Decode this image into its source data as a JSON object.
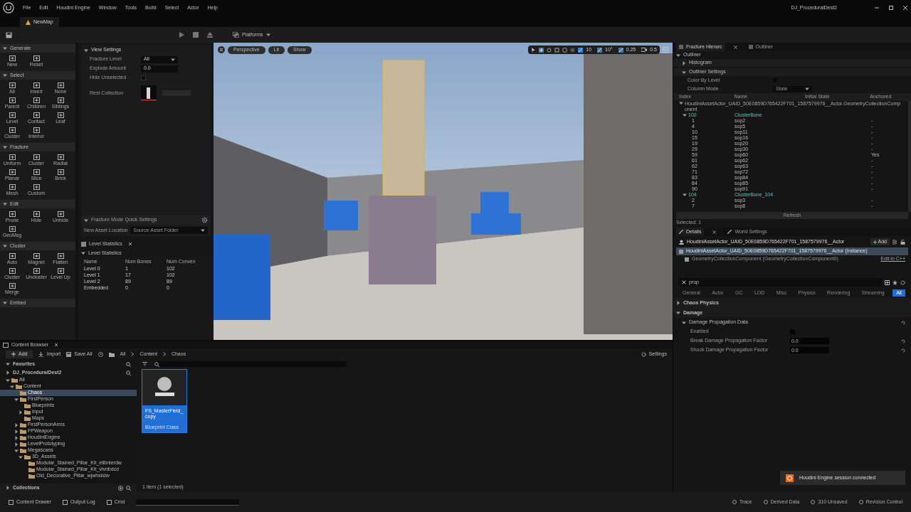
{
  "menu_bar": {
    "items": [
      "File",
      "Edit",
      "Houdini Engine",
      "Window",
      "Tools",
      "Build",
      "Select",
      "Actor",
      "Help"
    ],
    "project": "DJ_ProceduralDest2"
  },
  "level_tab": {
    "label": "NewMap"
  },
  "toolbar": {
    "platforms": "Platforms"
  },
  "fracture_palette": {
    "sections": [
      {
        "title": "Generate",
        "tools": [
          "New",
          "Reset"
        ]
      },
      {
        "title": "Select",
        "tools": [
          "All",
          "Invert",
          "None",
          "Parent",
          "Children",
          "Siblings",
          "Level",
          "Contact",
          "Leaf",
          "Cluster",
          "Interior"
        ]
      },
      {
        "title": "Fracture",
        "tools": [
          "Uniform",
          "Cluster",
          "Radial",
          "Planar",
          "Slice",
          "Brick",
          "Mesh",
          "Custom"
        ]
      },
      {
        "title": "Edit",
        "tools": [
          "Prune",
          "Hide",
          "Unhide",
          "GeoMsg"
        ]
      },
      {
        "title": "Cluster",
        "tools": [
          "Auto",
          "Magnet",
          "Flatten",
          "Cluster",
          "Uncluster",
          "Level Up",
          "Merge"
        ]
      },
      {
        "title": "Embed"
      }
    ]
  },
  "view_settings": {
    "title": "View Settings",
    "fields": [
      {
        "kind": "dropdown",
        "label": "Fracture Level",
        "value": "All"
      },
      {
        "kind": "number",
        "label": "Explode Amount",
        "value": "0.0"
      },
      {
        "kind": "checkbox",
        "label": "Hide Unselected",
        "checked": false
      },
      {
        "kind": "asset",
        "label": "Rest Collection"
      }
    ]
  },
  "quick_settings": {
    "title": "Fracture Mode Quick Settings",
    "label": "New Asset Location",
    "value": "Source Asset Folder"
  },
  "level_statistics": {
    "tab": "Level Statistics",
    "section": "Level Statistics",
    "columns": [
      "Name",
      "Num Bones",
      "Num Convex"
    ],
    "rows": [
      [
        "Level 0",
        "1",
        "102"
      ],
      [
        "Level 1",
        "17",
        "102"
      ],
      [
        "Level 2",
        "89",
        "89"
      ],
      [
        "Embedded",
        "0",
        "0"
      ]
    ]
  },
  "viewport": {
    "view_mode": "Perspective",
    "lighting": "Lit",
    "show": "Show",
    "grid_snap": "10",
    "rotation_snap": "10°",
    "scale_snap": "0.25",
    "camera_speed": "0.5"
  },
  "outliner_panel": {
    "tabs": [
      {
        "label": "Fracture Hierarc",
        "selected": true
      },
      {
        "label": "Outliner",
        "selected": false
      }
    ],
    "section": "Outliner",
    "histogram": "Histogram",
    "settings_title": "Outliner Settings",
    "color_by_level": {
      "label": "Color By Level",
      "checked": false
    },
    "column_mode": {
      "label": "Column Mode",
      "value": "State"
    },
    "columns": [
      "Index",
      "Name",
      "Initial State",
      "Anchored"
    ],
    "tree": [
      {
        "label": "HoudiniAssetActor_UAID_50E0859D765422F701_1587579976__Actor.GeometryCollectionComponent",
        "expanded": true,
        "children": [
          {
            "index": "102",
            "name": "ClusterBone",
            "expanded": true,
            "children": [
              {
                "index": "1",
                "name": "sop2",
                "anchored": "-"
              },
              {
                "index": "4",
                "name": "sop5",
                "anchored": "-"
              },
              {
                "index": "10",
                "name": "sop11",
                "anchored": "-"
              },
              {
                "index": "15",
                "name": "sop16",
                "anchored": "-"
              },
              {
                "index": "19",
                "name": "sop20",
                "anchored": "-"
              },
              {
                "index": "29",
                "name": "sop30",
                "anchored": "-"
              },
              {
                "index": "59",
                "name": "sop60",
                "anchored": "Yes"
              },
              {
                "index": "61",
                "name": "sop62",
                "anchored": "-"
              },
              {
                "index": "62",
                "name": "sop63",
                "anchored": "-"
              },
              {
                "index": "71",
                "name": "sop72",
                "anchored": "-"
              },
              {
                "index": "83",
                "name": "sop84",
                "anchored": "-"
              },
              {
                "index": "84",
                "name": "sop85",
                "anchored": "-"
              },
              {
                "index": "90",
                "name": "sop91",
                "anchored": "-"
              }
            ]
          },
          {
            "index": "104",
            "name": "ClusterBone_104",
            "expanded": true,
            "children": [
              {
                "index": "2",
                "name": "sop3",
                "anchored": "-"
              },
              {
                "index": "7",
                "name": "sop8",
                "anchored": "-"
              }
            ]
          }
        ]
      }
    ],
    "refresh": "Refresh",
    "selected_count": "Selected: 1"
  },
  "details": {
    "tabs": [
      {
        "label": "Details",
        "selected": true
      },
      {
        "label": "World Settings",
        "selected": false
      }
    ],
    "actor": "HoudiniAssetActor_UAID_50E0859D765422F701_1587579976__Actor",
    "add": "Add",
    "components": [
      {
        "label": "HoudiniAssetActor_UAID_50E0859D765422F701_1587579976__Actor (Instance)",
        "selected": true
      },
      {
        "label": "GeometryCollectionComponent (GeometryCollectionComponent0)",
        "selected": false,
        "action": "Edit in C++"
      }
    ],
    "search": "prop",
    "filters": [
      {
        "label": "General",
        "selected": false
      },
      {
        "label": "Actor",
        "selected": false
      },
      {
        "label": "GC",
        "selected": false
      },
      {
        "label": "LOD",
        "selected": false
      },
      {
        "label": "Misc",
        "selected": false
      },
      {
        "label": "Physics",
        "selected": false
      },
      {
        "label": "Rendering",
        "selected": false
      },
      {
        "label": "Streaming",
        "selected": false
      },
      {
        "label": "All",
        "selected": true
      }
    ],
    "properties": [
      {
        "kind": "category",
        "label": "Chaos Physics"
      },
      {
        "kind": "category",
        "label": "Damage"
      },
      {
        "kind": "group",
        "label": "Damage Propagation Data"
      },
      {
        "kind": "checkbox",
        "label": "Enabled",
        "checked": false
      },
      {
        "kind": "number",
        "label": "Break Damage Propagation Factor",
        "value": "0.0"
      },
      {
        "kind": "number",
        "label": "Shock Damage Propagation Factor",
        "value": "0.0"
      }
    ]
  },
  "content_browser": {
    "tab": "Content Browser",
    "add": "Add",
    "import": "Import",
    "save_all": "Save All",
    "breadcrumb": [
      "All",
      "Content",
      "Chaos"
    ],
    "settings": "Settings",
    "favorites": "Favorites",
    "project": "DJ_ProceduralDest2",
    "tree": [
      {
        "label": "All",
        "expanded": true,
        "selected": false,
        "children": [
          {
            "label": "Content",
            "expanded": true,
            "selected": false,
            "children": [
              {
                "label": "Chaos",
                "selected": true
              },
              {
                "label": "FirstPerson",
                "expanded": true,
                "selected": false,
                "children": [
                  {
                    "label": "Blueprints",
                    "selected": false
                  },
                  {
                    "label": "Input",
                    "expanded": false,
                    "selected": false
                  },
                  {
                    "label": "Maps",
                    "selected": false
                  }
                ]
              },
              {
                "label": "FirstPersonArms",
                "expanded": false,
                "selected": false
              },
              {
                "label": "FPWeapon",
                "expanded": false,
                "selected": false
              },
              {
                "label": "HoudiniEngine",
                "expanded": false,
                "selected": false
              },
              {
                "label": "LevelPrototyping",
                "expanded": false,
                "selected": false
              },
              {
                "label": "Megascans",
                "expanded": true,
                "selected": false,
                "children": [
                  {
                    "label": "3D_Assets",
                    "expanded": true,
                    "selected": false,
                    "children": [
                      {
                        "label": "Modular_Stained_Pillar_Kit_ellbnlerdw",
                        "selected": false
                      },
                      {
                        "label": "Modular_Stained_Pillar_Kit_vlvnbdcd",
                        "selected": false
                      },
                      {
                        "label": "Old_Decorative_Pillar_wjwhsiidw",
                        "selected": false
                      }
                    ]
                  }
                ]
              }
            ]
          }
        ]
      }
    ],
    "asset": {
      "name": "FS_MasterField_copy",
      "type": "Blueprint Class",
      "selected": true
    },
    "item_count": "1 item (1 selected)",
    "collections": "Collections"
  },
  "status_bar": {
    "left": [
      "Content Drawer",
      "Output Log",
      "Cmd"
    ],
    "right": [
      "Trace",
      "Derived Data",
      "310 Unsaved",
      "Revision Control"
    ]
  },
  "notification": "Houdini Engine session connected"
}
